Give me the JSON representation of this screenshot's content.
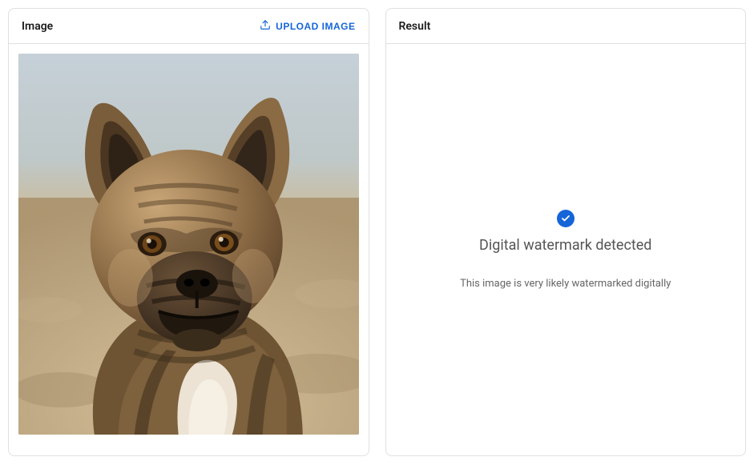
{
  "imagePanel": {
    "title": "Image",
    "uploadLabel": "UPLOAD IMAGE"
  },
  "resultPanel": {
    "title": "Result",
    "heading": "Digital watermark detected",
    "subtitle": "This image is very likely watermarked digitally"
  },
  "colors": {
    "accent": "#1565d8",
    "border": "#e0e0e0"
  }
}
